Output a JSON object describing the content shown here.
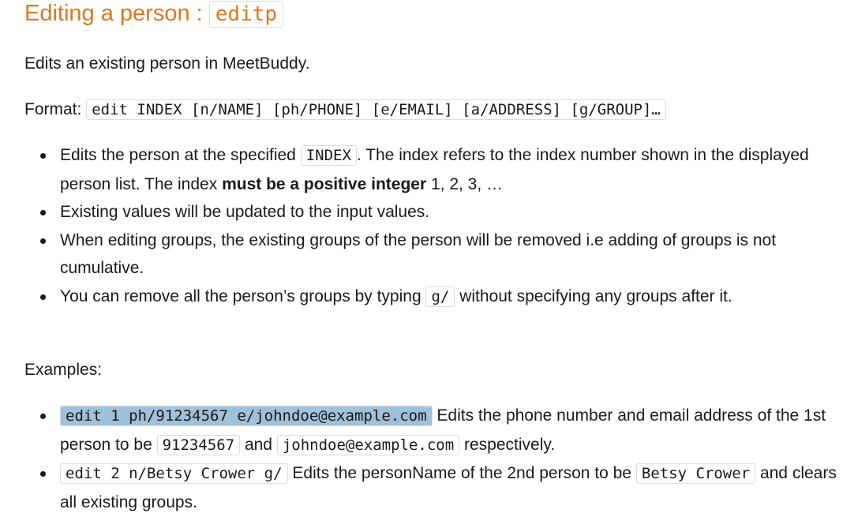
{
  "heading": {
    "text": "Editing a person : ",
    "code": "editp"
  },
  "intro": "Edits an existing person in MeetBuddy.",
  "format": {
    "label": "Format: ",
    "code": "edit INDEX [n/NAME] [ph/PHONE] [e/EMAIL] [a/ADDRESS] [g/GROUP]…"
  },
  "bullets": {
    "b1": {
      "pre": "Edits the person at the specified ",
      "code": "INDEX",
      "mid": ". The index refers to the index number shown in the displayed person list. The index ",
      "bold": "must be a positive integer",
      "post": " 1, 2, 3, …"
    },
    "b2": {
      "text": "Existing values will be updated to the input values."
    },
    "b3": {
      "text": "When editing groups, the existing groups of the person will be removed i.e adding of groups is not cumulative."
    },
    "b4": {
      "pre": "You can remove all the person’s groups by typing ",
      "code": "g/",
      "post": " without specifying any groups after it."
    }
  },
  "examples": {
    "label": "Examples:",
    "e1": {
      "code": "edit 1 ph/91234567 e/johndoe@example.com",
      "t1": " Edits the phone number and email address of the 1st person to be ",
      "c2": "91234567",
      "t2": " and ",
      "c3": "johndoe@example.com",
      "t3": " respectively."
    },
    "e2": {
      "code": "edit 2 n/Betsy Crower g/",
      "t1": " Edits the personName of the 2nd person to be ",
      "c2": "Betsy Crower",
      "t2": " and clears all existing groups."
    }
  }
}
